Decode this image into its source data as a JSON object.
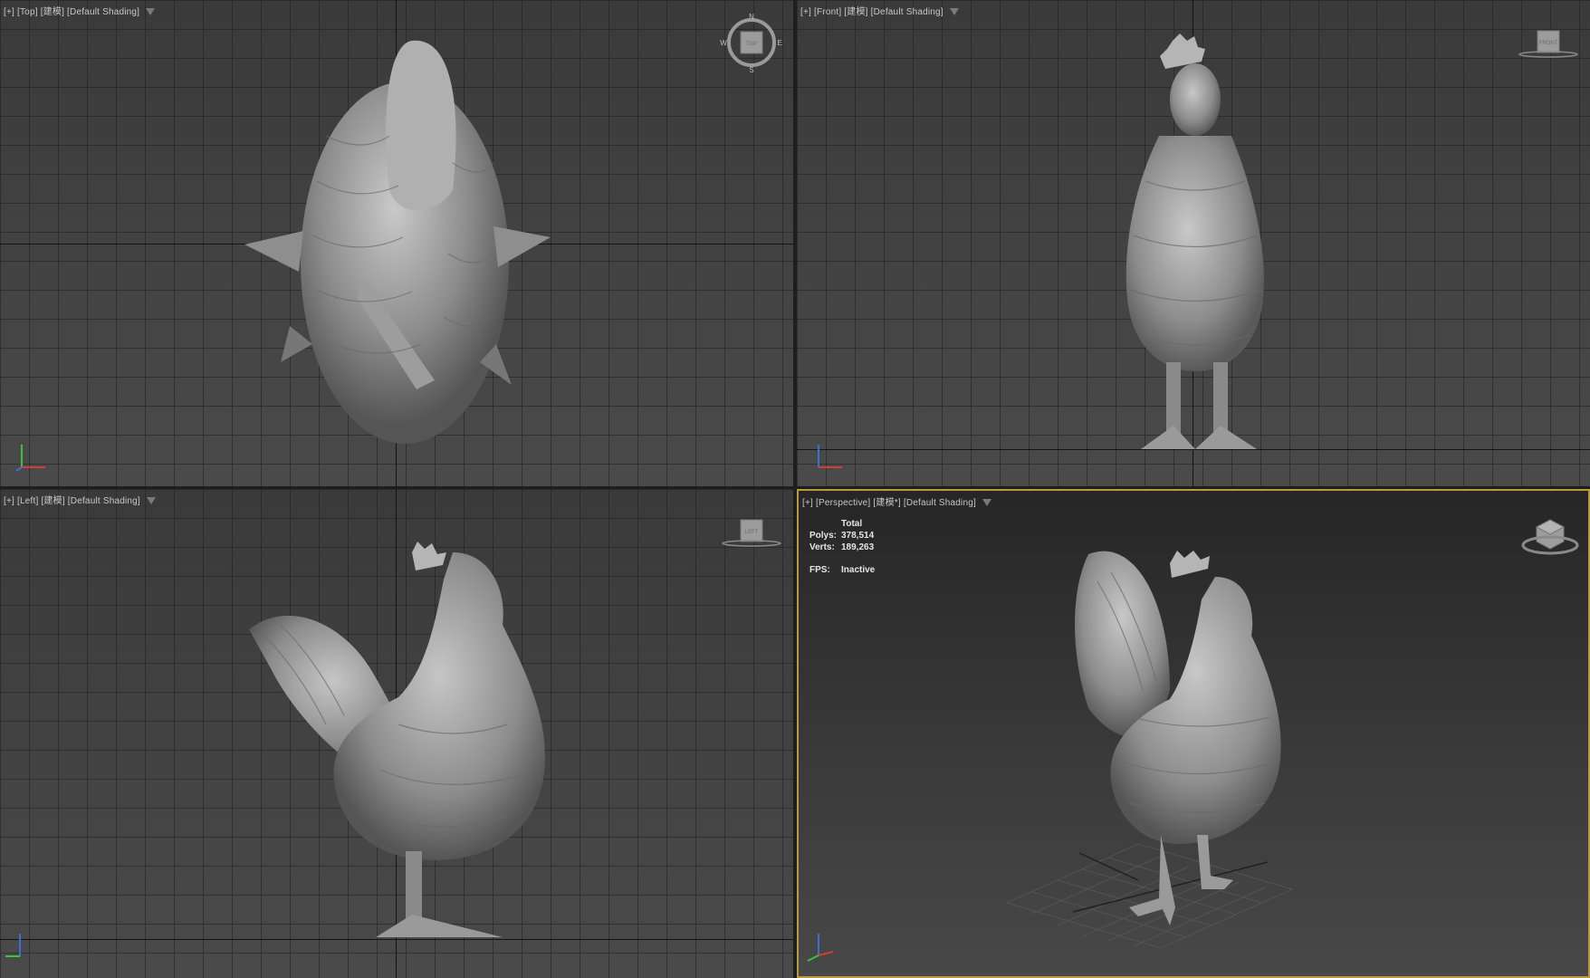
{
  "viewports": {
    "top": {
      "plus": "[+]",
      "view": "[Top]",
      "mode": "[建模]",
      "shading": "[Default Shading]"
    },
    "front": {
      "plus": "[+]",
      "view": "[Front]",
      "mode": "[建模]",
      "shading": "[Default Shading]",
      "cube_label": "FRONT"
    },
    "left": {
      "plus": "[+]",
      "view": "[Left]",
      "mode": "[建模]",
      "shading": "[Default Shading]",
      "cube_label": "LEFT"
    },
    "perspective": {
      "plus": "[+]",
      "view": "[Perspective]",
      "mode": "[建模*]",
      "shading": "[Default Shading]"
    }
  },
  "compass": {
    "n": "N",
    "s": "S",
    "e": "E",
    "w": "W",
    "cube_label": "TOP"
  },
  "stats": {
    "header": "Total",
    "polys_label": "Polys:",
    "polys_value": "378,514",
    "verts_label": "Verts:",
    "verts_value": "189,263",
    "fps_label": "FPS:",
    "fps_value": "Inactive"
  },
  "colors": {
    "active_border": "#b99a3c",
    "model": "#9a9a9a",
    "axis_x": "#d23c3c",
    "axis_y": "#3cc23c",
    "axis_z": "#3c6fd2"
  }
}
